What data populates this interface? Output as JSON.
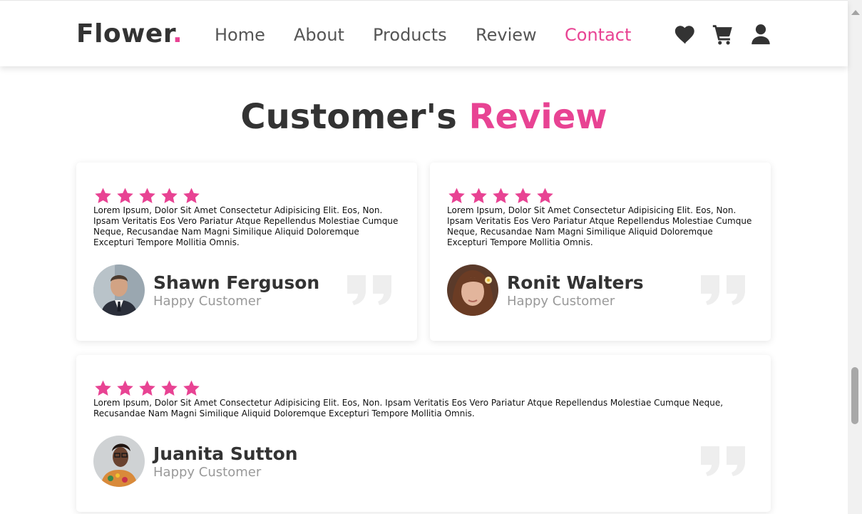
{
  "header": {
    "logo_text": "Flower",
    "logo_dot": ".",
    "nav": [
      {
        "label": "Home"
      },
      {
        "label": "About"
      },
      {
        "label": "Products"
      },
      {
        "label": "Review"
      },
      {
        "label": "Contact",
        "active": true
      }
    ],
    "icons": [
      "heart-icon",
      "cart-icon",
      "user-icon"
    ]
  },
  "section": {
    "title_part1": "Customer's",
    "title_part2": "Review"
  },
  "reviews": [
    {
      "rating": 5,
      "text": "Lorem Ipsum, Dolor Sit Amet Consectetur Adipisicing Elit. Eos, Non. Ipsam Veritatis Eos Vero Pariatur Atque Repellendus Molestiae Cumque Neque, Recusandae Nam Magni Similique Aliquid Doloremque Excepturi Tempore Mollitia Omnis.",
      "name": "Shawn Ferguson",
      "role": "Happy Customer"
    },
    {
      "rating": 5,
      "text": "Lorem Ipsum, Dolor Sit Amet Consectetur Adipisicing Elit. Eos, Non. Ipsam Veritatis Eos Vero Pariatur Atque Repellendus Molestiae Cumque Neque, Recusandae Nam Magni Similique Aliquid Doloremque Excepturi Tempore Mollitia Omnis.",
      "name": "Ronit Walters",
      "role": "Happy Customer"
    },
    {
      "rating": 5,
      "text": "Lorem Ipsum, Dolor Sit Amet Consectetur Adipisicing Elit. Eos, Non. Ipsam Veritatis Eos Vero Pariatur Atque Repellendus Molestiae Cumque Neque, Recusandae Nam Magni Similique Aliquid Doloremque Excepturi Tempore Mollitia Omnis.",
      "name": "Juanita Sutton",
      "role": "Happy Customer"
    }
  ],
  "colors": {
    "accent": "#e84393",
    "text_dark": "#333333",
    "text_muted": "#999999"
  }
}
